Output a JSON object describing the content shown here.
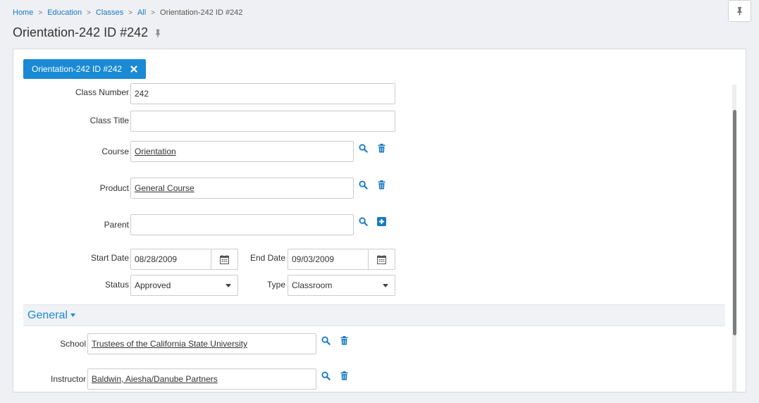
{
  "breadcrumb": {
    "items": [
      "Home",
      "Education",
      "Classes",
      "All"
    ],
    "current": "Orientation-242 ID #242"
  },
  "page": {
    "title": "Orientation-242 ID #242"
  },
  "tab": {
    "label": "Orientation-242 ID #242"
  },
  "form": {
    "class_number": {
      "label": "Class Number",
      "value": "242"
    },
    "class_title": {
      "label": "Class Title",
      "value": ""
    },
    "course": {
      "label": "Course",
      "value": "Orientation"
    },
    "product": {
      "label": "Product",
      "value": "General Course"
    },
    "parent": {
      "label": "Parent",
      "value": ""
    },
    "start_date": {
      "label": "Start Date",
      "value": "08/28/2009"
    },
    "end_date": {
      "label": "End Date",
      "value": "09/03/2009"
    },
    "status": {
      "label": "Status",
      "value": "Approved"
    },
    "type": {
      "label": "Type",
      "value": "Classroom"
    }
  },
  "section": {
    "label": "General"
  },
  "general": {
    "school": {
      "label": "School",
      "value": "Trustees of the California State University"
    },
    "instructor": {
      "label": "Instructor",
      "value": "Baldwin, Aiesha/Danube Partners"
    }
  },
  "icons": {
    "search": "search-icon",
    "trash": "trash-icon",
    "add": "plus-square-icon",
    "calendar": "calendar-icon",
    "pin": "pin-icon",
    "close": "close-icon"
  },
  "colors": {
    "accent": "#1a8ad4",
    "link": "#1a7ac4"
  }
}
